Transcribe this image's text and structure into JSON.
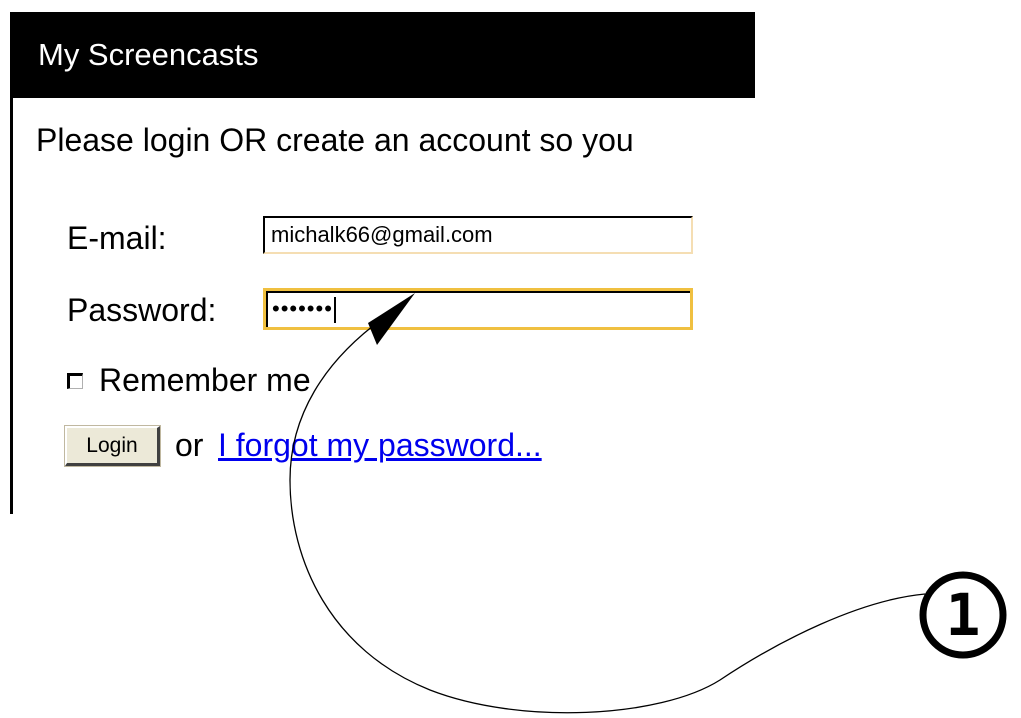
{
  "panel": {
    "title": "My Screencasts",
    "intro": "Please login OR create an account so you"
  },
  "form": {
    "email_label": "E-mail:",
    "email_value": "michalk66@gmail.com",
    "password_label": "Password:",
    "password_value": "•••••••",
    "remember_label": "Remember me",
    "remember_checked": false,
    "login_label": "Login",
    "or_text": "or",
    "forgot_link": "I forgot my password..."
  },
  "annotation": {
    "callout_number": "1",
    "arrow_target": "password-input"
  },
  "colors": {
    "header_bg": "#000000",
    "header_text": "#ffffff",
    "link": "#0000ee",
    "focus_border": "#f0c040",
    "button_bg": "#ece9d8"
  }
}
